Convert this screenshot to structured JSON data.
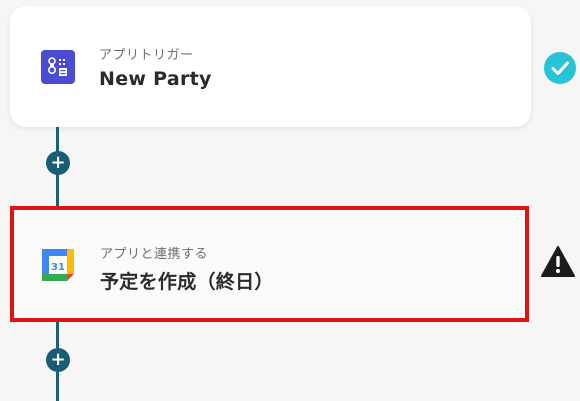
{
  "flow": {
    "steps": [
      {
        "subtitle": "アプリトリガー",
        "title": "New Party",
        "icon": "app-trigger-icon",
        "status": "check-icon",
        "status_color": "#27c3d7"
      },
      {
        "subtitle": "アプリと連携する",
        "title": "予定を作成（終日）",
        "icon": "google-calendar-icon",
        "status": "warning-icon",
        "status_color": "#1c1c1c"
      }
    ],
    "add_button_label": "+",
    "colors": {
      "connector": "#1f5f78",
      "highlight_border": "#e01414",
      "trigger_icon_bg": "#4b4bd6"
    }
  }
}
